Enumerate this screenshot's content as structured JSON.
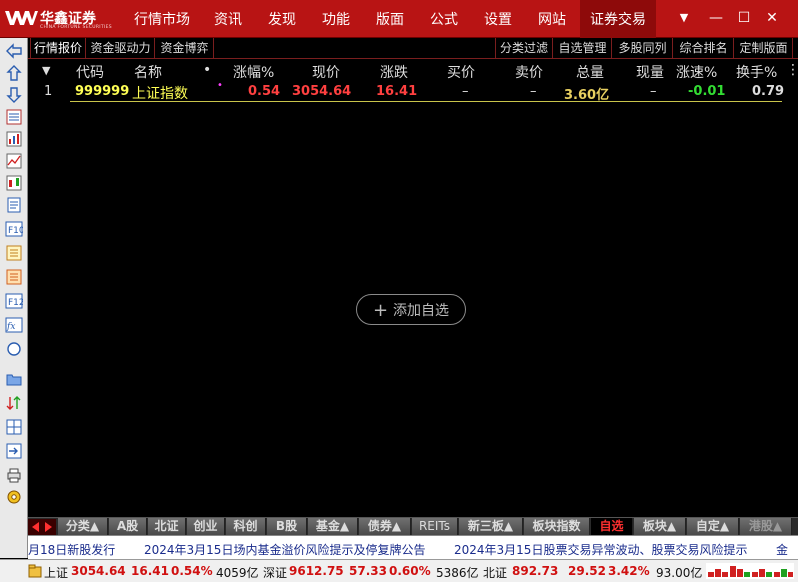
{
  "app": {
    "brand": "华鑫证券",
    "brand_en": "CHINA FORTUNE SECURITIES"
  },
  "menu": [
    {
      "label": "行情市场"
    },
    {
      "label": "资讯"
    },
    {
      "label": "发现"
    },
    {
      "label": "功能"
    },
    {
      "label": "版面"
    },
    {
      "label": "公式"
    },
    {
      "label": "设置"
    },
    {
      "label": "网站"
    },
    {
      "label": "证券交易"
    }
  ],
  "window_controls": {
    "dropdown": "▼",
    "minimize": "—",
    "maximize": "☐",
    "close": "✕"
  },
  "tabs_left": [
    "行情报价",
    "资金驱动力",
    "资金博弈"
  ],
  "tabs_right": [
    "分类过滤",
    "自选管理",
    "多股同列",
    "综合排名",
    "定制版面"
  ],
  "table": {
    "sort_arrow": "▼",
    "dot": "•",
    "columns": [
      "代码",
      "名称",
      "涨幅%",
      "现价",
      "涨跌",
      "买价",
      "卖价",
      "总量",
      "现量",
      "涨速%",
      "换手%"
    ],
    "more": "⋮",
    "rows": [
      {
        "index": "1",
        "code": "999999",
        "name": "上证指数",
        "marker": "•",
        "change_pct": "0.54",
        "price": "3054.64",
        "change": "16.41",
        "bid": "–",
        "ask": "–",
        "volume": "3.60亿",
        "cur_volume": "–",
        "speed": "-0.01",
        "turnover": "0.79"
      }
    ]
  },
  "add_button": {
    "plus": "+",
    "label": "添加自选"
  },
  "category_tabs": [
    {
      "label": "分类▲"
    },
    {
      "label": "A股"
    },
    {
      "label": "北证"
    },
    {
      "label": "创业"
    },
    {
      "label": "科创"
    },
    {
      "label": "B股"
    },
    {
      "label": "基金▲"
    },
    {
      "label": "债券▲"
    },
    {
      "label": "REITs"
    },
    {
      "label": "新三板▲"
    },
    {
      "label": "板块指数"
    },
    {
      "label": "自选"
    },
    {
      "label": "板块▲"
    },
    {
      "label": "自定▲"
    },
    {
      "label": "港股▲"
    }
  ],
  "news": [
    "月18日新股发行",
    "2024年3月15日场内基金溢价风险提示及停复牌公告",
    "2024年3月15日股票交易异常波动、股票交易风险提示",
    "金"
  ],
  "status": {
    "sh_label": "上证",
    "sh_price": "3054.64",
    "sh_change": "16.41",
    "sh_pct": "0.54%",
    "sh_amount": "4059亿",
    "sz_label": "深证",
    "sz_price": "9612.75",
    "sz_change": "57.33",
    "sz_pct": "0.60%",
    "sz_amount": "5386亿",
    "bz_label": "北证",
    "bz_price": "892.73",
    "bz_change": "29.52",
    "bz_pct": "3.42%",
    "bz_amount": "93.00亿"
  },
  "colors": {
    "title_bar": "#b81414",
    "up": "#ff4040",
    "down": "#33dd33",
    "code": "#ffff55"
  }
}
